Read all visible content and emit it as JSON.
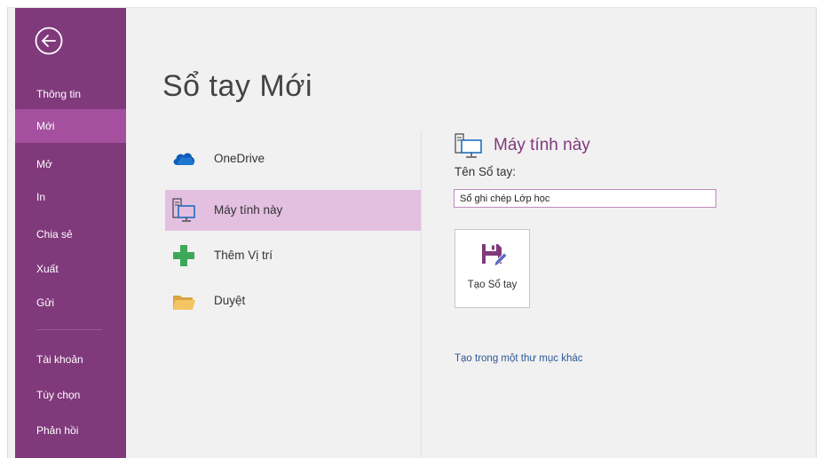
{
  "sidebar": {
    "back_icon": "back-arrow-circle-icon",
    "items": [
      {
        "label": "Thông tin"
      },
      {
        "label": "Mới"
      },
      {
        "label": "Mở"
      },
      {
        "label": "In"
      },
      {
        "label": "Chia sẻ"
      },
      {
        "label": "Xuất"
      },
      {
        "label": "Gửi"
      },
      {
        "label": "Tài khoản"
      },
      {
        "label": "Tùy chọn"
      },
      {
        "label": "Phản hồi"
      }
    ],
    "active_item": "Mới",
    "background_color": "#80397b",
    "active_color": "#a4509e"
  },
  "main": {
    "title": "Sổ tay Mới",
    "locations": [
      {
        "label": "OneDrive",
        "icon": "onedrive-cloud-icon"
      },
      {
        "label": "Máy tính này",
        "icon": "computer-icon"
      },
      {
        "label": "Thêm Vị trí",
        "icon": "plus-icon"
      },
      {
        "label": "Duyệt",
        "icon": "folder-icon"
      }
    ],
    "selected_location": "Máy tính này",
    "selected_color": "#e3bfe0"
  },
  "detail": {
    "heading": "Máy tính này",
    "heading_icon": "computer-icon",
    "name_label": "Tên Sổ tay:",
    "name_value": "Sổ ghi chép Lớp học",
    "create_button_label": "Tạo Sổ tay",
    "create_button_icon": "save-notebook-icon",
    "other_folder_link": "Tạo trong một thư mục khác",
    "accent_color": "#80397b",
    "link_color": "#2b5797"
  }
}
